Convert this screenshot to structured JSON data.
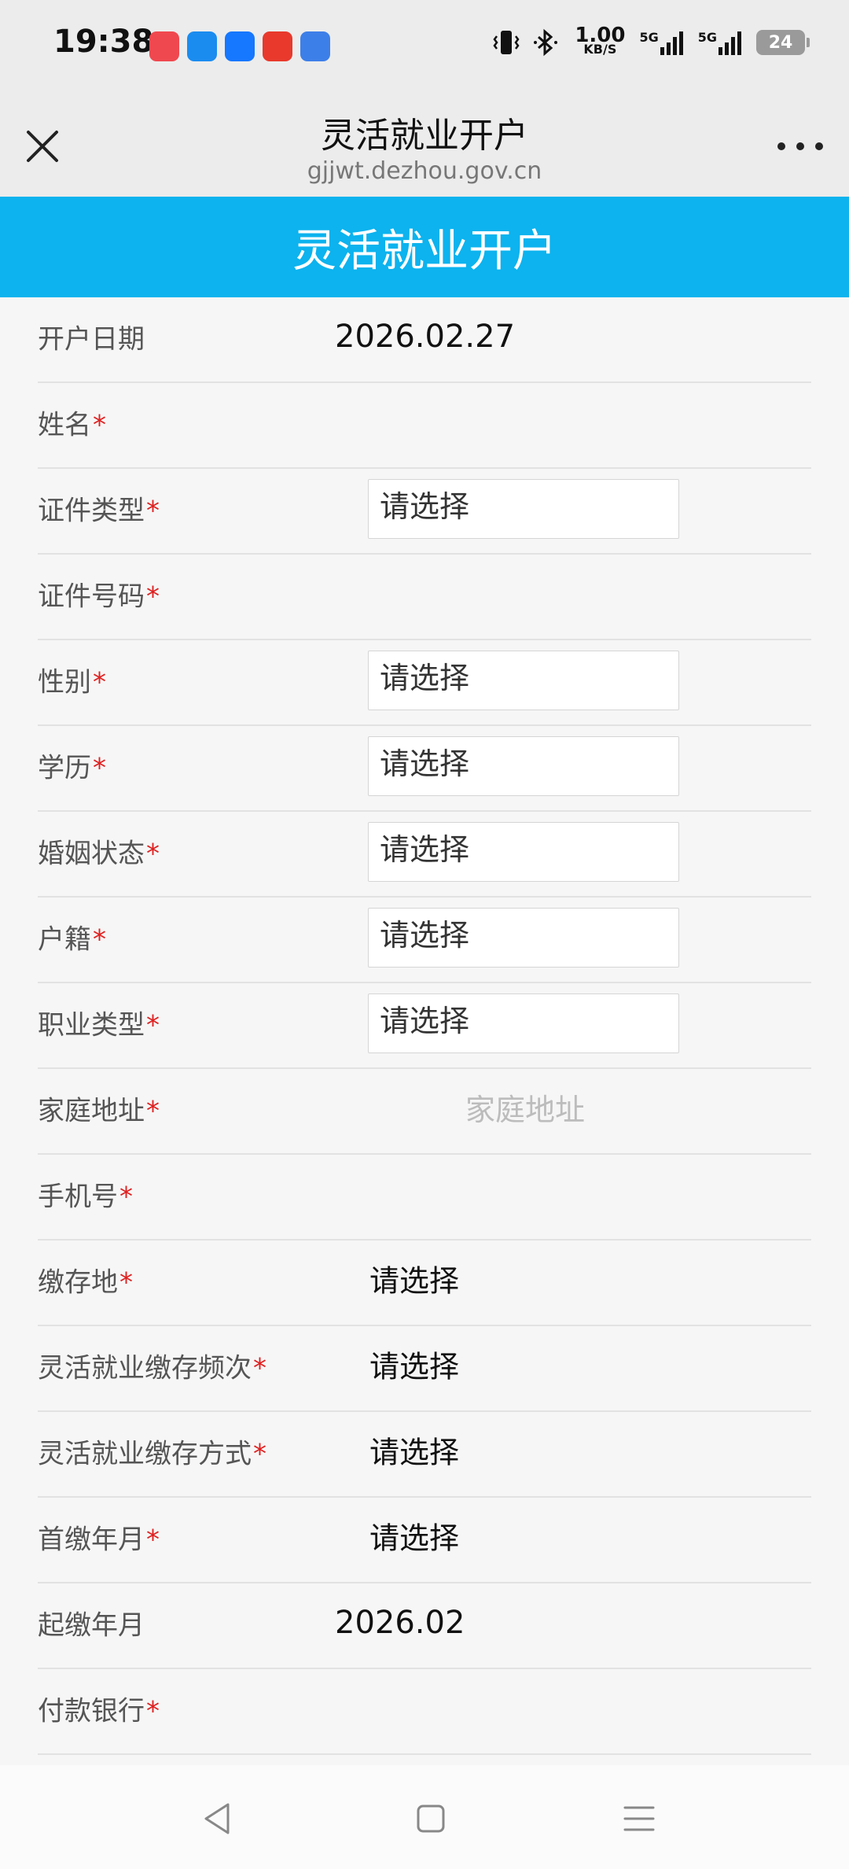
{
  "status_bar": {
    "time": "19:38",
    "net_speed_value": "1.00",
    "net_speed_unit": "KB/S",
    "signal1_label": "5G",
    "signal2_label": "5G",
    "battery": "24",
    "app_icons": [
      {
        "name": "app-icon-1",
        "color": "#f0484f"
      },
      {
        "name": "app-icon-2",
        "color": "#1a8cf0"
      },
      {
        "name": "alipay-icon",
        "color": "#1677ff"
      },
      {
        "name": "toutiao-icon",
        "color": "#e8392c"
      },
      {
        "name": "app-icon-5",
        "color": "#3d7fe8"
      }
    ]
  },
  "browser": {
    "title": "灵活就业开户",
    "url": "gjjwt.dezhou.gov.cn"
  },
  "header": {
    "title": "灵活就业开户",
    "color": "#0cb3ee"
  },
  "form": {
    "fields": [
      {
        "label": "开户日期",
        "required": "",
        "value": "2026.02.27"
      },
      {
        "label": "姓名",
        "required": "*"
      },
      {
        "label": "证件类型",
        "required": "*",
        "select": "请选择"
      },
      {
        "label": "证件号码",
        "required": "*"
      },
      {
        "label": "性别",
        "required": "*",
        "select": "请选择"
      },
      {
        "label": "学历",
        "required": "*",
        "select": "请选择"
      },
      {
        "label": "婚姻状态",
        "required": "*",
        "select": "请选择"
      },
      {
        "label": "户籍",
        "required": "*",
        "select": "请选择"
      },
      {
        "label": "职业类型",
        "required": "*",
        "select": "请选择"
      },
      {
        "label": "家庭地址",
        "required": "*",
        "placeholder": "家庭地址"
      },
      {
        "label": "手机号",
        "required": "*"
      },
      {
        "label": "缴存地",
        "required": "*",
        "select": "请选择"
      },
      {
        "label": "灵活就业缴存频次",
        "required": "*",
        "select": "请选择"
      },
      {
        "label": "灵活就业缴存方式",
        "required": "*",
        "select": "请选择"
      },
      {
        "label": "首缴年月",
        "required": "*",
        "select": "请选择"
      },
      {
        "label": "起缴年月",
        "required": "",
        "value": "2026.02"
      },
      {
        "label": "付款银行",
        "required": "*"
      }
    ]
  }
}
